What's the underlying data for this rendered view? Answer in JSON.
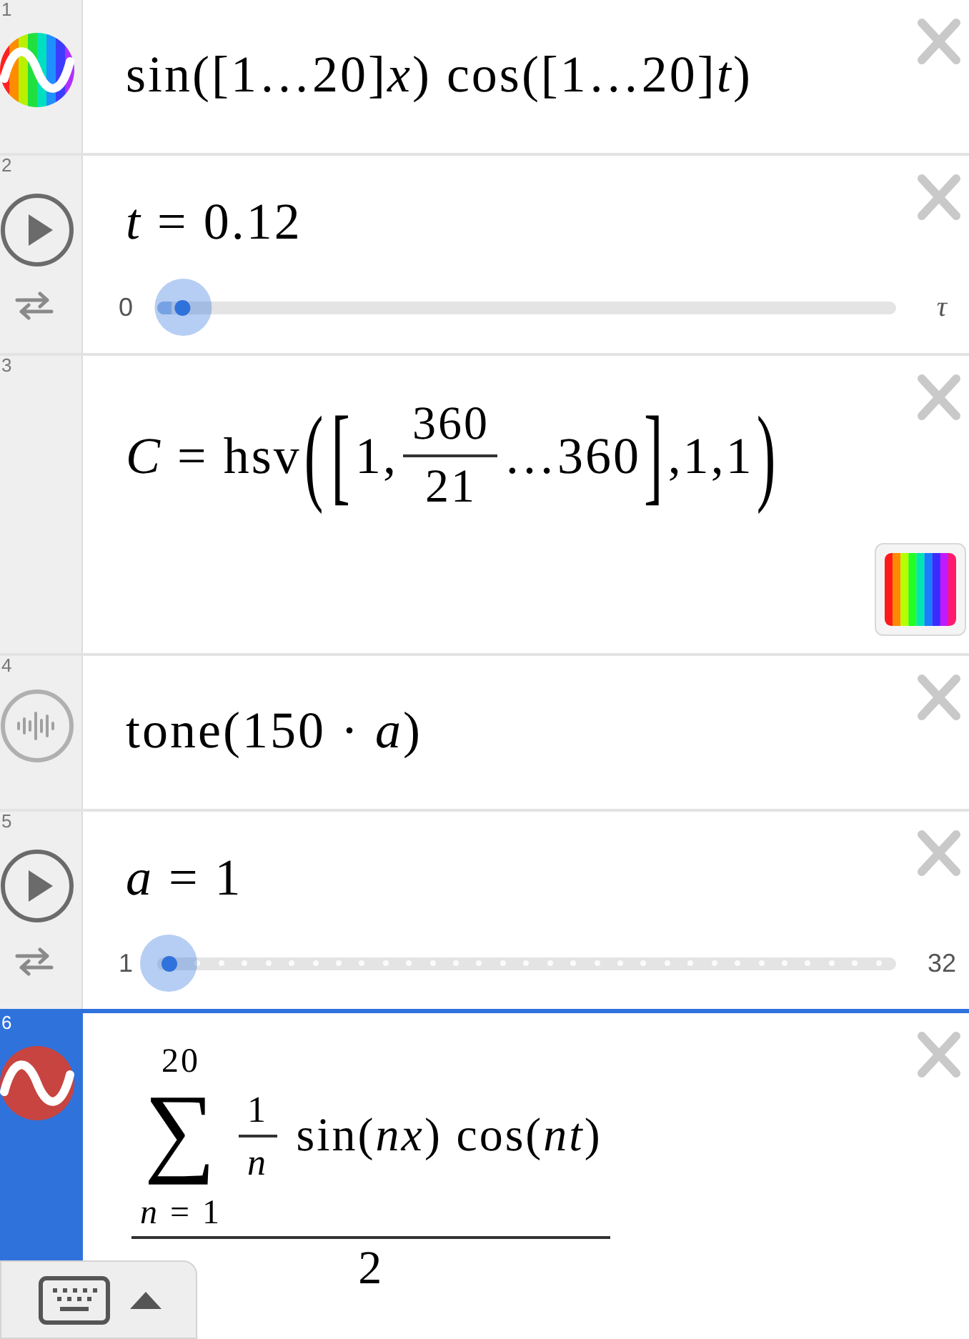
{
  "expressions": [
    {
      "number": "1",
      "selected": false,
      "icons": [
        {
          "kind": "rainbow-wave"
        }
      ],
      "formula": [
        {
          "kind": "text",
          "text": "sin([1…20]*x*) cos([1…20]*t*)"
        }
      ]
    },
    {
      "number": "2",
      "selected": false,
      "icons": [
        {
          "kind": "play"
        },
        {
          "kind": "repeat"
        }
      ],
      "formula": [
        {
          "kind": "text",
          "text": "*t* = 0.12"
        }
      ],
      "slider": {
        "min": {
          "text": "0",
          "math": false
        },
        "max": {
          "text": "τ",
          "math": true
        },
        "level": 0.02,
        "stepped": false
      }
    },
    {
      "number": "3",
      "selected": false,
      "formula": [
        {
          "kind": "text",
          "text": "*C* = hsv"
        },
        {
          "kind": "delim",
          "text": "("
        },
        {
          "kind": "delim",
          "text": "["
        },
        {
          "kind": "text",
          "text": "1,"
        },
        {
          "kind": "frac",
          "numerator": [
            {
              "kind": "text",
              "text": "360"
            }
          ],
          "denominator": [
            {
              "kind": "text",
              "text": "21"
            }
          ]
        },
        {
          "kind": "text",
          "text": "…360"
        },
        {
          "kind": "delim",
          "text": "]"
        },
        {
          "kind": "text",
          "text": ",1,1"
        },
        {
          "kind": "delim",
          "text": ")"
        }
      ],
      "swatch": {
        "kind": "rainbow"
      }
    },
    {
      "number": "4",
      "selected": false,
      "icons": [
        {
          "kind": "tone"
        }
      ],
      "formula": [
        {
          "kind": "text",
          "text": "tone(150 · *a*)"
        }
      ]
    },
    {
      "number": "5",
      "selected": false,
      "icons": [
        {
          "kind": "play"
        },
        {
          "kind": "repeat"
        }
      ],
      "formula": [
        {
          "kind": "text",
          "text": "*a* = 1"
        }
      ],
      "slider": {
        "min": {
          "text": "1",
          "math": false
        },
        "max": {
          "text": "32",
          "math": false
        },
        "level": 0,
        "stepped": true
      }
    },
    {
      "number": "6",
      "selected": true,
      "icons": [
        {
          "kind": "wave",
          "color": "#c74440"
        }
      ],
      "formula": [
        {
          "kind": "frac",
          "numerator": [
            {
              "kind": "sum",
              "symbol": "∑",
              "upper": "20",
              "lower": "*n* = 1"
            },
            {
              "kind": "frac",
              "numerator": [
                {
                  "kind": "text",
                  "text": "1"
                }
              ],
              "denominator": [
                {
                  "kind": "text",
                  "text": "*n*"
                }
              ]
            },
            {
              "kind": "text",
              "text": " sin(*nx*) cos(*nt*)"
            }
          ],
          "denominator": [
            {
              "kind": "text",
              "text": "2"
            }
          ]
        }
      ]
    }
  ],
  "keyboard_toggle": {
    "expanded": false
  }
}
